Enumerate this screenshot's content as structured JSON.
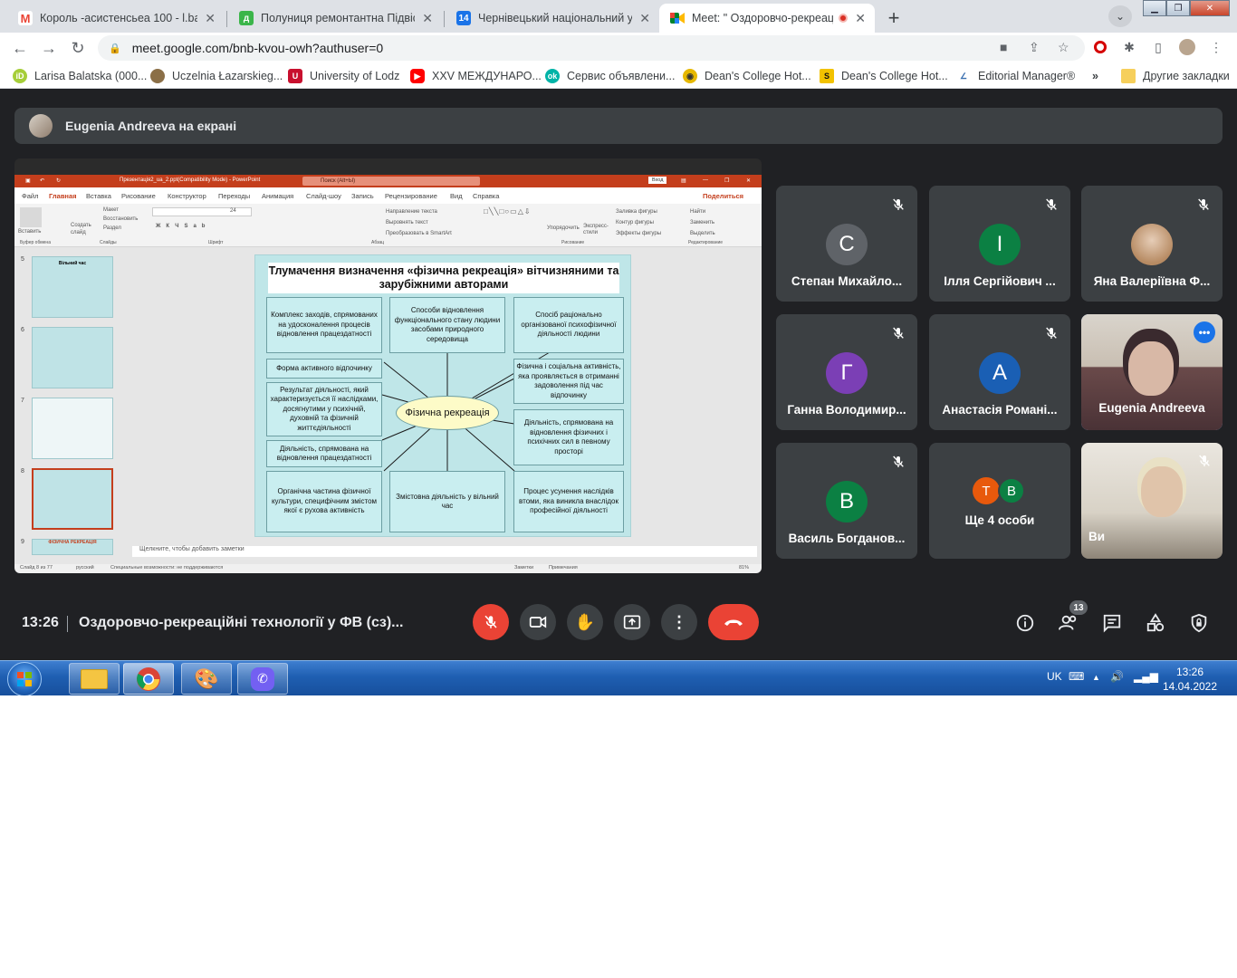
{
  "browser": {
    "tabs": [
      {
        "title": "Король -асистенсьеа 100 - l.bal",
        "icon": "gmail-icon",
        "active": false
      },
      {
        "title": "Полуниця ремонтантна Підвісн",
        "icon": "green-d-icon",
        "active": false
      },
      {
        "title": "Чернівецький національний ун",
        "icon": "calendar-icon",
        "active": false
      },
      {
        "title": "Meet: \" Оздоровчо-рекреаці",
        "icon": "meet-icon",
        "active": true
      }
    ],
    "url": "meet.google.com/bnb-kvou-owh?authuser=0",
    "bookmarks": [
      {
        "label": "Larisa Balatska (000...",
        "color": "#a6ce39",
        "glyph": "iD"
      },
      {
        "label": "Uczelnia Łazarskieg...",
        "color": "#8b6f47",
        "glyph": ""
      },
      {
        "label": "University of Lodz",
        "color": "#c8102e",
        "glyph": "U"
      },
      {
        "label": "XXV МЕЖДУНАРО...",
        "color": "#ff0000",
        "glyph": "▶"
      },
      {
        "label": "Сервис объявлени...",
        "color": "#00b3a7",
        "glyph": "ok"
      },
      {
        "label": "Dean's College Hot...",
        "color": "#e6b800",
        "glyph": "◉"
      },
      {
        "label": "Dean's College Hot...",
        "color": "#f2c200",
        "glyph": "S"
      },
      {
        "label": "Editorial Manager®",
        "color": "#3a6fb0",
        "glyph": "∠"
      }
    ],
    "bookmarks_more": "»",
    "other_bookmarks": "Другие закладки"
  },
  "meet": {
    "presenter_banner": "Eugenia Andreeva на екрані",
    "participants": [
      {
        "name": "Степан Михайло...",
        "initial": "С",
        "color": "#5f6368",
        "muted": true
      },
      {
        "name": "Ілля Сергійович ...",
        "initial": "І",
        "color": "#0b8043",
        "muted": true
      },
      {
        "name": "Яна Валеріївна Ф...",
        "initial": "",
        "color": "#c9a27e",
        "muted": true
      },
      {
        "name": "Ганна Володимир...",
        "initial": "Г",
        "color": "#7b3fb5",
        "muted": true
      },
      {
        "name": "Анастасія Романі...",
        "initial": "А",
        "color": "#1a5fb4",
        "muted": true
      },
      {
        "name": "Eugenia Andreeva",
        "initial": "",
        "color": "#8a7a6a",
        "muted": false
      },
      {
        "name": "Василь Богданов...",
        "initial": "В",
        "color": "#0b8043",
        "muted": true
      },
      {
        "name": "Ще 4 особи",
        "initial": "",
        "color": "#3c4043",
        "muted": false
      },
      {
        "name": "Ви",
        "initial": "",
        "color": "#a48a6e",
        "muted": true
      }
    ],
    "more_people": {
      "a": "Т",
      "b": "В",
      "a_color": "#e8590c",
      "b_color": "#0b8043"
    },
    "time": "13:26",
    "meeting_title": "Оздоровчо-рекреаційні технології у ФВ (сз)...",
    "participant_count": "13"
  },
  "powerpoint": {
    "title": "Презентація2_ua_2.ppt(Compatibility Mode) - PowerPoint",
    "search": "Поиск (Alt+Ы)",
    "signin": "Вход",
    "menu": [
      "Файл",
      "Главная",
      "Вставка",
      "Рисование",
      "Конструктор",
      "Переходы",
      "Анимация",
      "Слайд-шоу",
      "Запись",
      "Рецензирование",
      "Вид",
      "Справка"
    ],
    "share": "Поделиться",
    "ribbon_groups": [
      "Буфер обмена",
      "Слайды",
      "Шрифт",
      "Абзац",
      "Рисование",
      "Редактирование"
    ],
    "ribbon_labels": {
      "paste": "Вставить",
      "create_slide": "Создать слайд",
      "layout": "Макет",
      "restore": "Восстановить",
      "section": "Раздел",
      "text_direction": "Направление текста",
      "align_text": "Выровнять текст",
      "smartart": "Преобразовать в SmartArt",
      "arrange": "Упорядочить",
      "quick_styles": "Экспресс-стили",
      "shape_fill": "Заливка фигуры",
      "shape_outline": "Контур фигуры",
      "shape_effects": "Эффекты фигуры",
      "find": "Найти",
      "replace": "Заменить",
      "select": "Выделить"
    },
    "font_size": "24",
    "thumb_numbers": [
      "5",
      "6",
      "7",
      "8",
      "9"
    ],
    "thumb_5_title": "Вільний час",
    "thumb_9_title": "ФІЗИЧНА РЕКРЕАЦІЯ",
    "notes": "Щелкните, чтобы добавить заметки",
    "status_left": "Слайд 8 из 77",
    "status_lang": "русский",
    "status_access": "Специальные возможности: не поддерживаются",
    "status_notes": "Заметки",
    "status_comments": "Примечания",
    "zoom": "81%"
  },
  "slide": {
    "title": "Тлумачення визначення «фізична рекреація» вітчизняними та зарубіжними авторами",
    "center": "Фізична рекреація",
    "boxes": {
      "b1": "Комплекс заходів, спрямованих на удосконалення процесів відновлення працездатності",
      "b2": "Способи відновлення функціонального стану людини засобами природного середовища",
      "b3": "Спосіб раціонально організованої психофізичної діяльності людини",
      "b4": "Форма активного відпочинку",
      "b5": "Результат діяльності, який характеризується її наслідками, досягнутими у психічній, духовній та фізичній життєдіяльності",
      "b6": "Діяльність, спрямована на відновлення працездатності",
      "b7": "Фізична і соціальна активність, яка проявляється в отриманні задоволення під час відпочинку",
      "b8": "Діяльність, спрямована на відновлення фізичних і психічних сил в певному просторі",
      "b9": "Органічна частина фізичної культури, специфічним змістом якої є рухова активність",
      "b10": "Змістовна діяльність у вільний час",
      "b11": "Процес усунення наслідків втоми, яка виникла внаслідок професійної діяльності"
    }
  },
  "taskbar": {
    "lang": "UK",
    "time": "13:26",
    "date": "14.04.2022"
  }
}
